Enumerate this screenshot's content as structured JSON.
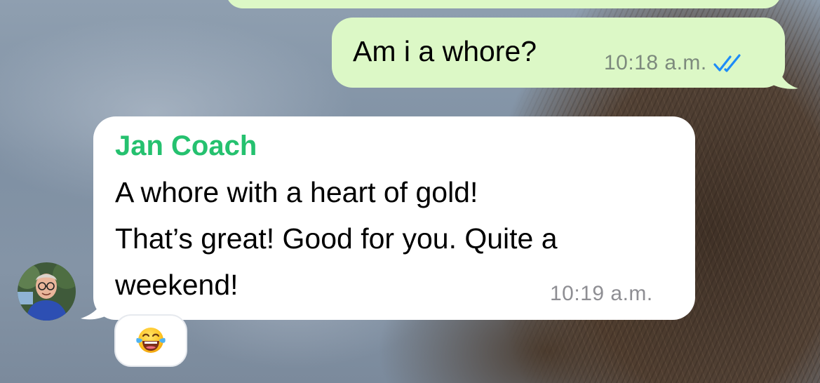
{
  "conversation": {
    "messages": [
      {
        "direction": "outgoing",
        "text": "Am i a whore?",
        "time": "10:18 a.m.",
        "status_icon": "double-check-read-icon",
        "bubble_color": "#dcf8c6"
      },
      {
        "direction": "incoming",
        "sender": "Jan Coach",
        "sender_color": "#25c16f",
        "text_lines": [
          "A whore with a heart of gold!",
          "That’s great! Good for you. Quite a",
          "weekend!"
        ],
        "time": "10:19 a.m.",
        "avatar_icon": "contact-avatar",
        "reaction": {
          "emoji": "😂",
          "icon": "face-with-tears-of-joy-icon"
        },
        "bubble_color": "#ffffff"
      }
    ]
  },
  "theme": {
    "read_tick_color": "#1d8cf8",
    "timestamp_color": "#8e8e93"
  }
}
